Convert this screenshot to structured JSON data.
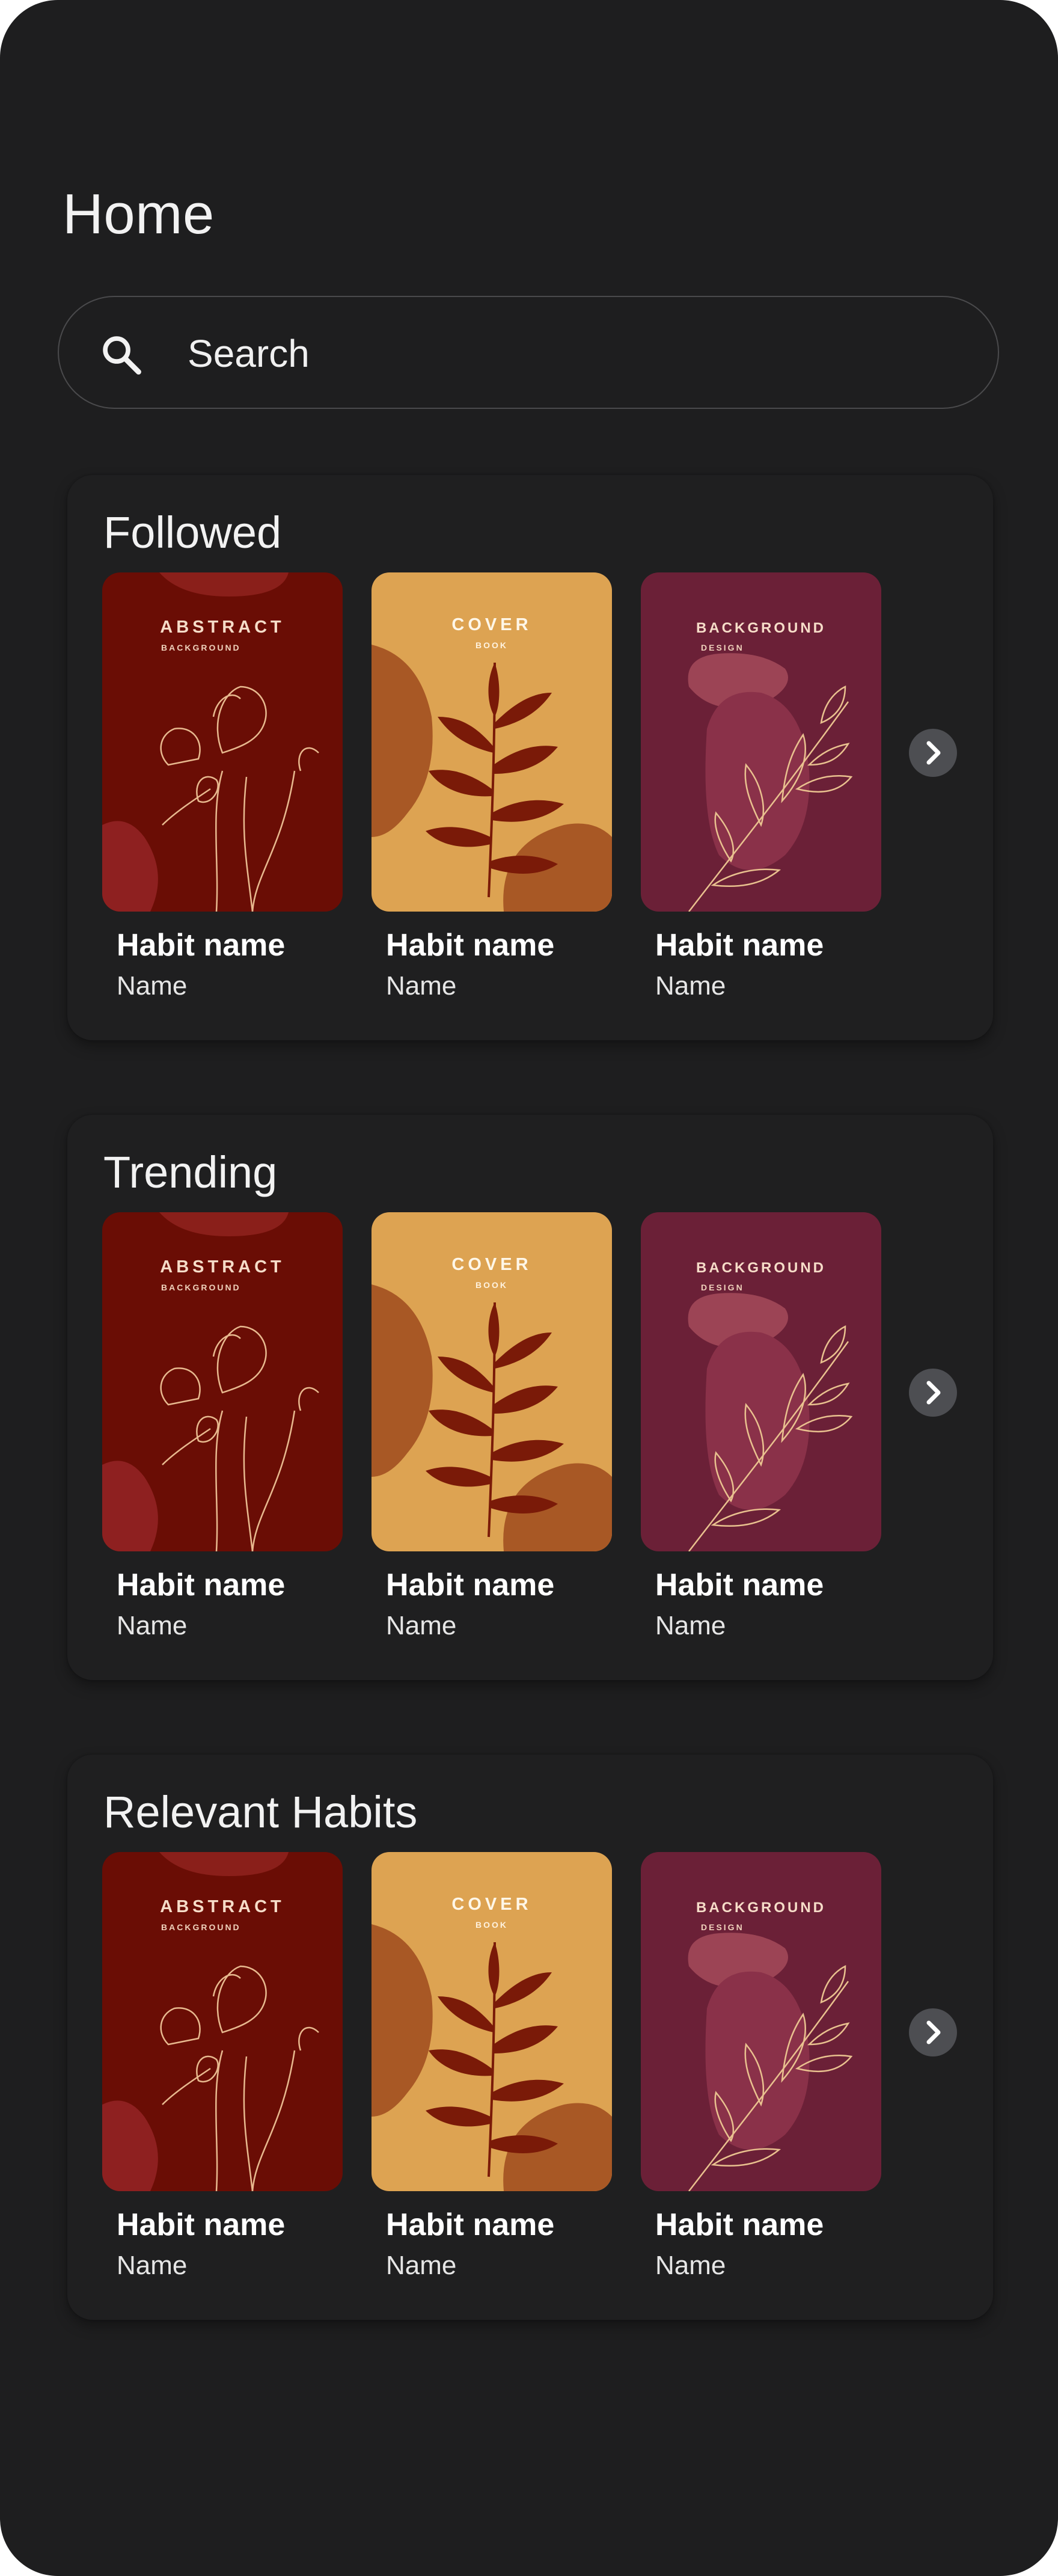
{
  "header": {
    "title": "Home"
  },
  "search": {
    "placeholder": "Search",
    "icon": "search-icon"
  },
  "sections": [
    {
      "title": "Followed",
      "cards": [
        {
          "name": "Habit name",
          "author": "Name",
          "cover": {
            "title": "ABSTRACT",
            "subtitle": "BACKGROUND",
            "style": "abstract"
          }
        },
        {
          "name": "Habit name",
          "author": "Name",
          "cover": {
            "title": "COVER",
            "subtitle": "BOOK",
            "style": "cover"
          }
        },
        {
          "name": "Habit name",
          "author": "Name",
          "cover": {
            "title": "BACKGROUND",
            "subtitle": "DESIGN",
            "style": "background"
          }
        }
      ],
      "next_icon": "chevron-right-icon"
    },
    {
      "title": "Trending",
      "cards": [
        {
          "name": "Habit name",
          "author": "Name",
          "cover": {
            "title": "ABSTRACT",
            "subtitle": "BACKGROUND",
            "style": "abstract"
          }
        },
        {
          "name": "Habit name",
          "author": "Name",
          "cover": {
            "title": "COVER",
            "subtitle": "BOOK",
            "style": "cover"
          }
        },
        {
          "name": "Habit name",
          "author": "Name",
          "cover": {
            "title": "BACKGROUND",
            "subtitle": "DESIGN",
            "style": "background"
          }
        }
      ],
      "next_icon": "chevron-right-icon"
    },
    {
      "title": "Relevant Habits",
      "cards": [
        {
          "name": "Habit name",
          "author": "Name",
          "cover": {
            "title": "ABSTRACT",
            "subtitle": "BACKGROUND",
            "style": "abstract"
          }
        },
        {
          "name": "Habit name",
          "author": "Name",
          "cover": {
            "title": "COVER",
            "subtitle": "BOOK",
            "style": "cover"
          }
        },
        {
          "name": "Habit name",
          "author": "Name",
          "cover": {
            "title": "BACKGROUND",
            "subtitle": "DESIGN",
            "style": "background"
          }
        }
      ],
      "next_icon": "chevron-right-icon"
    }
  ],
  "colors": {
    "background": "#1e1e1f",
    "card_surface": "#1f1f20",
    "abstract_cover": "#6a0d05",
    "book_cover": "#dda352",
    "design_cover": "#6b2037",
    "button": "#4d4e52"
  }
}
